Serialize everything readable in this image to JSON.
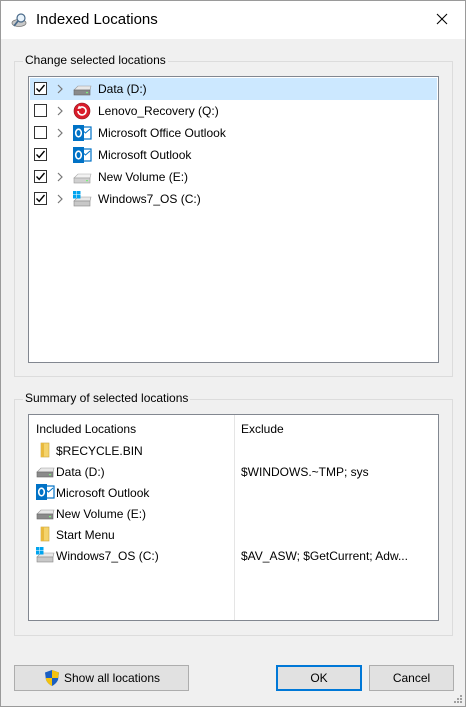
{
  "window": {
    "title": "Indexed Locations",
    "title_icon": "indexed-locations-icon",
    "close_icon": "close-icon"
  },
  "change_group": {
    "label": "Change selected locations",
    "items": [
      {
        "label": "Data (D:)",
        "checked": true,
        "has_chevron": true,
        "icon": "drive-icon",
        "selected": true
      },
      {
        "label": "Lenovo_Recovery (Q:)",
        "checked": false,
        "has_chevron": true,
        "icon": "recovery-drive-icon",
        "selected": false
      },
      {
        "label": "Microsoft Office Outlook",
        "checked": false,
        "has_chevron": true,
        "icon": "outlook-icon",
        "selected": false
      },
      {
        "label": "Microsoft Outlook",
        "checked": true,
        "has_chevron": false,
        "icon": "outlook-icon",
        "selected": false
      },
      {
        "label": "New Volume (E:)",
        "checked": true,
        "has_chevron": true,
        "icon": "drive-icon",
        "selected": false
      },
      {
        "label": "Windows7_OS (C:)",
        "checked": true,
        "has_chevron": true,
        "icon": "windows-drive-icon",
        "selected": false
      }
    ]
  },
  "summary_group": {
    "label": "Summary of selected locations",
    "col_included": "Included Locations",
    "col_exclude": "Exclude",
    "rows": [
      {
        "label": "$RECYCLE.BIN",
        "exclude": "",
        "icon": "folder-icon"
      },
      {
        "label": "Data (D:)",
        "exclude": "$WINDOWS.~TMP; sys",
        "icon": "drive-icon"
      },
      {
        "label": "Microsoft Outlook",
        "exclude": "",
        "icon": "outlook-icon"
      },
      {
        "label": "New Volume (E:)",
        "exclude": "",
        "icon": "drive-icon"
      },
      {
        "label": "Start Menu",
        "exclude": "",
        "icon": "folder-icon"
      },
      {
        "label": "Windows7_OS (C:)",
        "exclude": "$AV_ASW; $GetCurrent; Adw...",
        "icon": "windows-drive-icon"
      }
    ]
  },
  "buttons": {
    "show_all": "Show all locations",
    "show_all_icon": "uac-shield-icon",
    "ok": "OK",
    "cancel": "Cancel"
  },
  "colors": {
    "selection": "#cce8ff",
    "accent": "#0078d7",
    "outlook_blue": "#0072c6"
  }
}
